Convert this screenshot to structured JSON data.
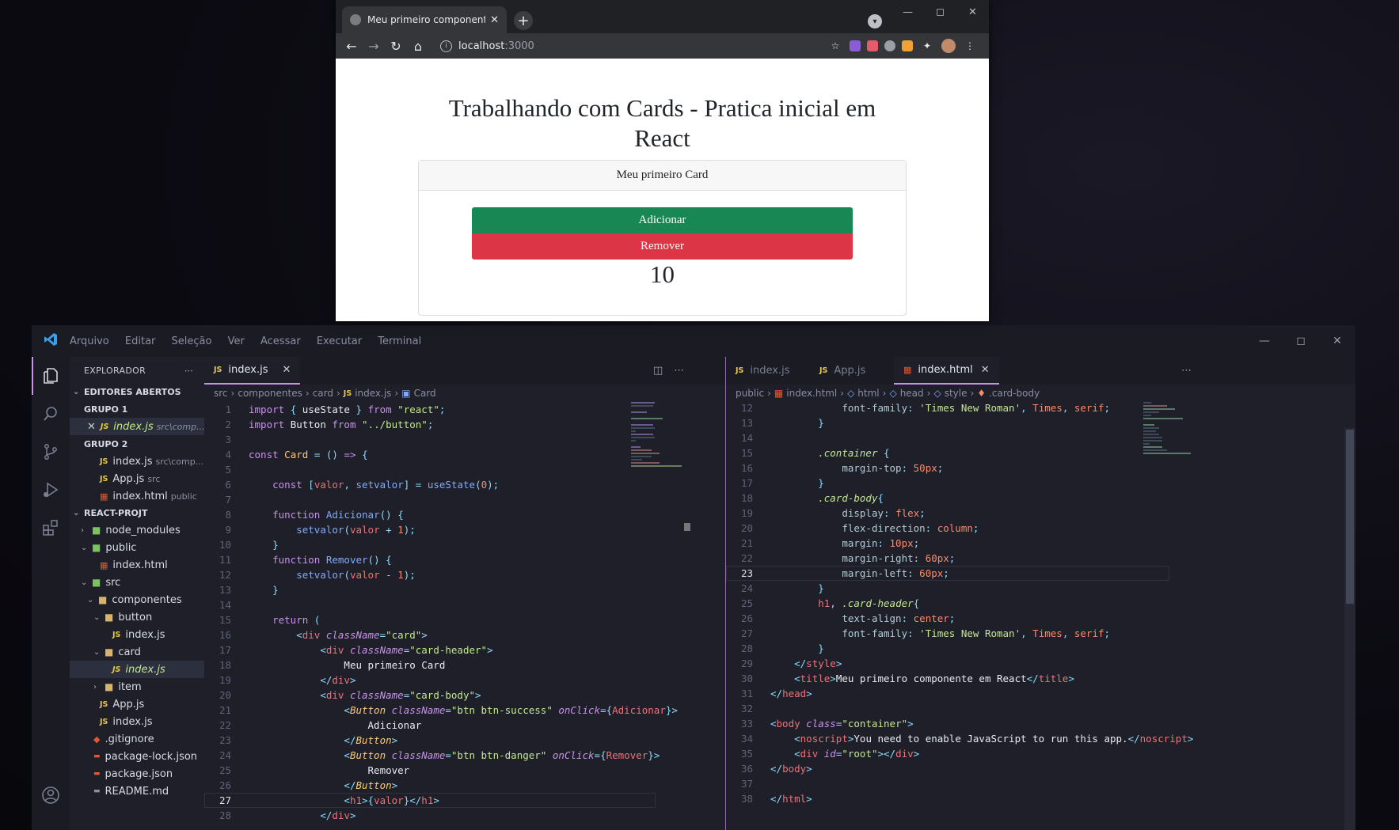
{
  "vscode": {
    "menu": [
      "Arquivo",
      "Editar",
      "Seleção",
      "Ver",
      "Acessar",
      "Executar",
      "Terminal"
    ],
    "explorer": {
      "title": "EXPLORADOR",
      "open_editors": "EDITORES ABERTOS",
      "group1": "GRUPO 1",
      "group1_items": [
        {
          "name": "index.js",
          "hint": "src\\comp..."
        }
      ],
      "group2": "GRUPO 2",
      "group2_items": [
        {
          "name": "index.js",
          "hint": "src\\comp..."
        },
        {
          "name": "App.js",
          "hint": "src"
        },
        {
          "name": "index.html",
          "hint": "public"
        }
      ],
      "project": "REACT-PROJT",
      "tree": {
        "node_modules": "node_modules",
        "public": "public",
        "public_index": "index.html",
        "src": "src",
        "componentes": "componentes",
        "button": "button",
        "button_index": "index.js",
        "card": "card",
        "card_index": "index.js",
        "item": "item",
        "app": "App.js",
        "src_index": "index.js",
        "gitignore": ".gitignore",
        "package_lock": "package-lock.json",
        "package": "package.json",
        "readme": "README.md"
      }
    },
    "left_pane": {
      "tab": "index.js",
      "breadcrumb": [
        "src",
        "componentes",
        "card",
        "index.js",
        "Card"
      ]
    },
    "right_pane": {
      "tabs": [
        "index.js",
        "App.js",
        "index.html"
      ],
      "breadcrumb": [
        "public",
        "index.html",
        "html",
        "head",
        "style",
        ".card-body"
      ]
    }
  },
  "browser": {
    "tab_title": "Meu primeiro componente em R",
    "url_host": "localhost",
    "url_port": ":3000",
    "page": {
      "heading_line1": "Trabalhando com Cards - Pratica inicial em",
      "heading_line2": "React",
      "card_header": "Meu primeiro Card",
      "btn_add": "Adicionar",
      "btn_remove": "Remover",
      "value": "10"
    },
    "colors": {
      "success": "#198754",
      "danger": "#dc3545"
    }
  }
}
